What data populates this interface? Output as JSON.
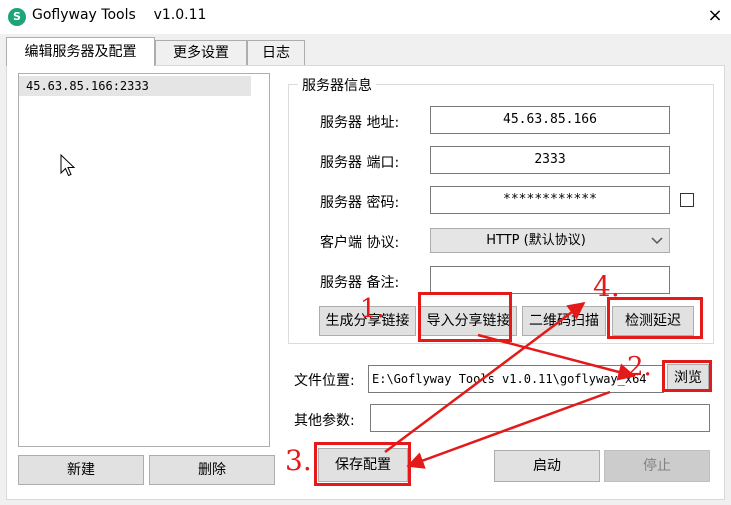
{
  "window": {
    "app_name": "Goflyway Tools",
    "version": "v1.0.11",
    "close_glyph": "×"
  },
  "tabs": [
    {
      "label": "编辑服务器及配置",
      "active": true
    },
    {
      "label": "更多设置",
      "active": false
    },
    {
      "label": "日志",
      "active": false
    }
  ],
  "server_list": {
    "items": [
      "45.63.85.166:2333"
    ]
  },
  "left_buttons": {
    "new_label": "新建",
    "delete_label": "删除"
  },
  "server_info": {
    "group_title": "服务器信息",
    "address_label": "服务器 地址:",
    "address_value": "45.63.85.166",
    "port_label": "服务器 端口:",
    "port_value": "2333",
    "password_label": "服务器 密码:",
    "password_value": "************",
    "protocol_label": "客户端 协议:",
    "protocol_value": "HTTP (默认协议)",
    "note_label": "服务器 备注:",
    "note_value": ""
  },
  "action_buttons": {
    "generate_share": "生成分享链接",
    "import_share": "导入分享链接",
    "qr_scan": "二维码扫描",
    "test_latency": "检测延迟"
  },
  "file": {
    "label": "文件位置:",
    "value": "E:\\Goflyway Tools v1.0.11\\goflyway_x64",
    "browse_label": "浏览"
  },
  "other_params": {
    "label": "其他参数:",
    "value": ""
  },
  "bottom_buttons": {
    "save": "保存配置",
    "start": "启动",
    "stop": "停止"
  },
  "annotations": {
    "n1": "1.",
    "n2": "2.",
    "n3": "3.",
    "n4": "4.",
    "color": "#e41a1a"
  }
}
